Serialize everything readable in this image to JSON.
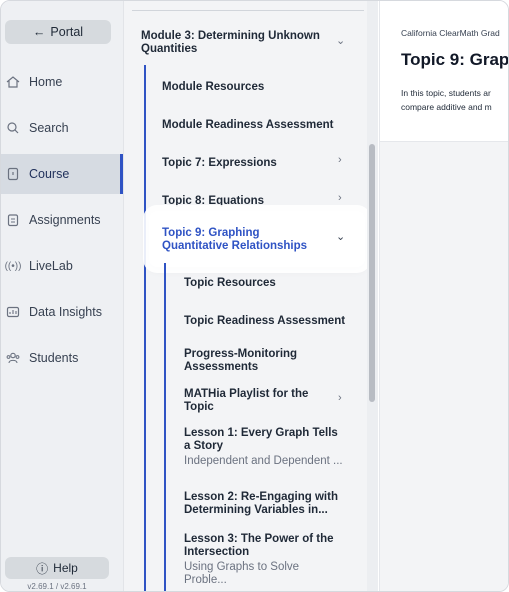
{
  "sidebar": {
    "portal_label": "Portal",
    "items": [
      {
        "label": "Home",
        "icon": "home-icon"
      },
      {
        "label": "Search",
        "icon": "search-icon"
      },
      {
        "label": "Course",
        "icon": "course-icon",
        "active": true
      },
      {
        "label": "Assignments",
        "icon": "assignments-icon"
      },
      {
        "label": "LiveLab",
        "icon": "livelab-icon"
      },
      {
        "label": "Data Insights",
        "icon": "data-insights-icon"
      },
      {
        "label": "Students",
        "icon": "students-icon"
      }
    ],
    "help_label": "Help",
    "version": "v2.69.1 / v2.69.1"
  },
  "panel": {
    "module_title": "Module 3: Determining Unknown Quantities",
    "module_resources": "Module Resources",
    "module_readiness": "Module Readiness Assessment",
    "topic7": "Topic 7: Expressions",
    "topic8": "Topic 8: Equations",
    "topic9": "Topic 9: Graphing Quantitative Relationships",
    "topic_resources": "Topic Resources",
    "topic_readiness": "Topic Readiness Assessment",
    "progress_monitoring": "Progress-Monitoring Assessments",
    "mathia_playlist": "MATHia Playlist for the Topic",
    "lesson1_title": "Lesson 1: Every Graph Tells a Story",
    "lesson1_sub": "Independent and Dependent ...",
    "lesson2_title": "Lesson 2: Re-Engaging with Determining Variables in...",
    "lesson3_title": "Lesson 3: The Power of the Intersection",
    "lesson3_sub": "Using Graphs to Solve Proble..."
  },
  "content": {
    "breadcrumb": "California ClearMath Grad",
    "title": "Topic 9: Grapl",
    "desc_line1": "In this topic, students ar",
    "desc_line2": "compare additive and m"
  },
  "colors": {
    "accent": "#2f53c4",
    "rail_bg": "#eef0f3",
    "panel_bg": "#f3f4f6"
  }
}
